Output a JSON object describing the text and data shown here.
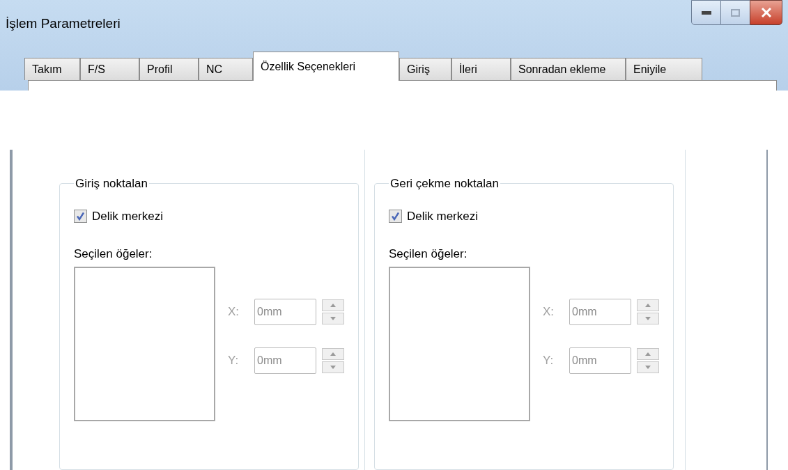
{
  "window": {
    "title": "İşlem Parametreleri"
  },
  "tabs": [
    {
      "label": "Takım",
      "selected": false
    },
    {
      "label": "F/S",
      "selected": false
    },
    {
      "label": "Profil",
      "selected": false
    },
    {
      "label": "NC",
      "selected": false
    },
    {
      "label": "Özellik Seçenekleri",
      "selected": true
    },
    {
      "label": "Giriş",
      "selected": false
    },
    {
      "label": "İleri",
      "selected": false
    },
    {
      "label": "Sonradan ekleme",
      "selected": false
    },
    {
      "label": "Eniyile",
      "selected": false
    }
  ],
  "groups": [
    {
      "title": "Giriş noktalan",
      "checkbox": {
        "label": "Delik merkezi",
        "checked": true
      },
      "list_label": "Seçilen öğeler:",
      "coordinates": [
        {
          "label": "X:",
          "value": "0mm",
          "disabled": true
        },
        {
          "label": "Y:",
          "value": "0mm",
          "disabled": true
        }
      ]
    },
    {
      "title": "Geri çekme noktalan",
      "checkbox": {
        "label": "Delik merkezi",
        "checked": true
      },
      "list_label": "Seçilen öğeler:",
      "coordinates": [
        {
          "label": "X:",
          "value": "0mm",
          "disabled": true
        },
        {
          "label": "Y:",
          "value": "0mm",
          "disabled": true
        }
      ]
    }
  ]
}
